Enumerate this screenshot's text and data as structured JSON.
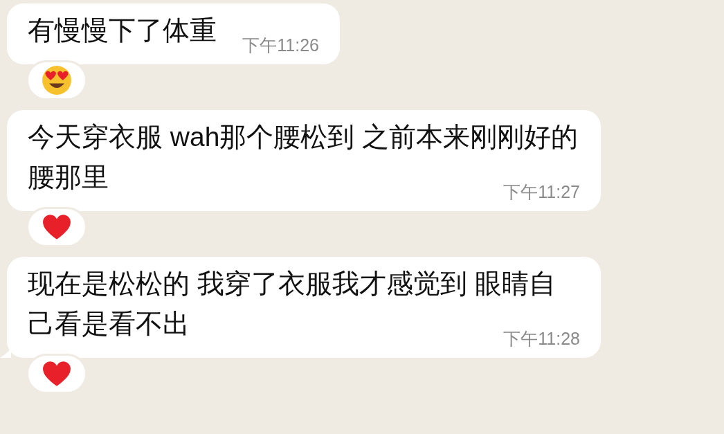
{
  "messages": [
    {
      "text": "有慢慢下了体重",
      "time": "下午11:26",
      "tail": false,
      "reaction": {
        "kind": "heart-eyes"
      }
    },
    {
      "text": "今天穿衣服 wah那个腰松到 之前本来刚刚好的腰那里",
      "time": "下午11:27",
      "tail": false,
      "reaction": {
        "kind": "heart"
      }
    },
    {
      "text": "现在是松松的 我穿了衣服我才感觉到 眼睛自己看是看不出",
      "time": "下午11:28",
      "tail": true,
      "reaction": {
        "kind": "heart"
      }
    }
  ]
}
